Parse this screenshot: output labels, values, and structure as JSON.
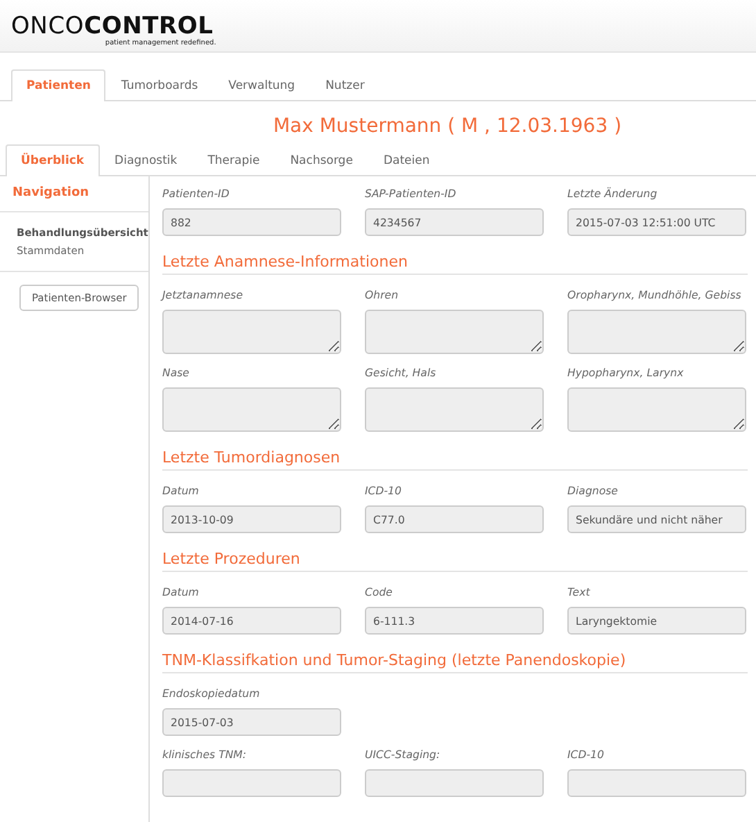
{
  "logo": {
    "light": "ONCO",
    "bold": "CONTROL",
    "tagline": "patient management redefined."
  },
  "main_tabs": [
    {
      "label": "Patienten",
      "selected": true
    },
    {
      "label": "Tumorboards",
      "selected": false
    },
    {
      "label": "Verwaltung",
      "selected": false
    },
    {
      "label": "Nutzer",
      "selected": false
    }
  ],
  "patient_title": "Max Mustermann ( M , 12.03.1963 )",
  "sub_tabs": [
    {
      "label": "Überblick",
      "selected": true
    },
    {
      "label": "Diagnostik",
      "selected": false
    },
    {
      "label": "Therapie",
      "selected": false
    },
    {
      "label": "Nachsorge",
      "selected": false
    },
    {
      "label": "Dateien",
      "selected": false
    }
  ],
  "sidebar": {
    "heading": "Navigation",
    "items": [
      {
        "label": "Behandlungsübersicht",
        "selected": true
      },
      {
        "label": "Stammdaten",
        "selected": false
      }
    ],
    "button": "Patienten-Browser"
  },
  "sections": [
    {
      "rows": [
        [
          {
            "kind": "input",
            "label": "Patienten-ID",
            "value": "882"
          },
          {
            "kind": "input",
            "label": "SAP-Patienten-ID",
            "value": "4234567"
          },
          {
            "kind": "input",
            "label": "Letzte Änderung",
            "value": "2015-07-03 12:51:00 UTC"
          }
        ]
      ]
    },
    {
      "title": "Letzte Anamnese-Informationen",
      "rows": [
        [
          {
            "kind": "textarea",
            "label": "Jetztanamnese"
          },
          {
            "kind": "textarea",
            "label": "Ohren"
          },
          {
            "kind": "textarea",
            "label": "Oropharynx, Mundhöhle, Gebiss"
          }
        ],
        [
          {
            "kind": "textarea",
            "label": "Nase"
          },
          {
            "kind": "textarea",
            "label": "Gesicht, Hals"
          },
          {
            "kind": "textarea",
            "label": "Hypopharynx, Larynx"
          }
        ]
      ]
    },
    {
      "title": "Letzte Tumordiagnosen",
      "rows": [
        [
          {
            "kind": "input",
            "label": "Datum",
            "value": "2013-10-09"
          },
          {
            "kind": "input",
            "label": "ICD-10",
            "value": "C77.0"
          },
          {
            "kind": "input",
            "label": "Diagnose",
            "value": "Sekundäre und nicht näher"
          }
        ]
      ]
    },
    {
      "title": "Letzte Prozeduren",
      "rows": [
        [
          {
            "kind": "input",
            "label": "Datum",
            "value": "2014-07-16"
          },
          {
            "kind": "input",
            "label": "Code",
            "value": "6-111.3"
          },
          {
            "kind": "input",
            "label": "Text",
            "value": "Laryngektomie"
          }
        ]
      ]
    },
    {
      "title": "TNM-Klassifkation und Tumor-Staging (letzte Panendoskopie)",
      "rows": [
        [
          {
            "kind": "input",
            "label": "Endoskopiedatum",
            "value": "2015-07-03"
          }
        ],
        [
          {
            "kind": "input",
            "label": "klinisches TNM:"
          },
          {
            "kind": "input",
            "label": "UICC-Staging:"
          },
          {
            "kind": "input",
            "label": "ICD-10"
          }
        ]
      ]
    }
  ]
}
